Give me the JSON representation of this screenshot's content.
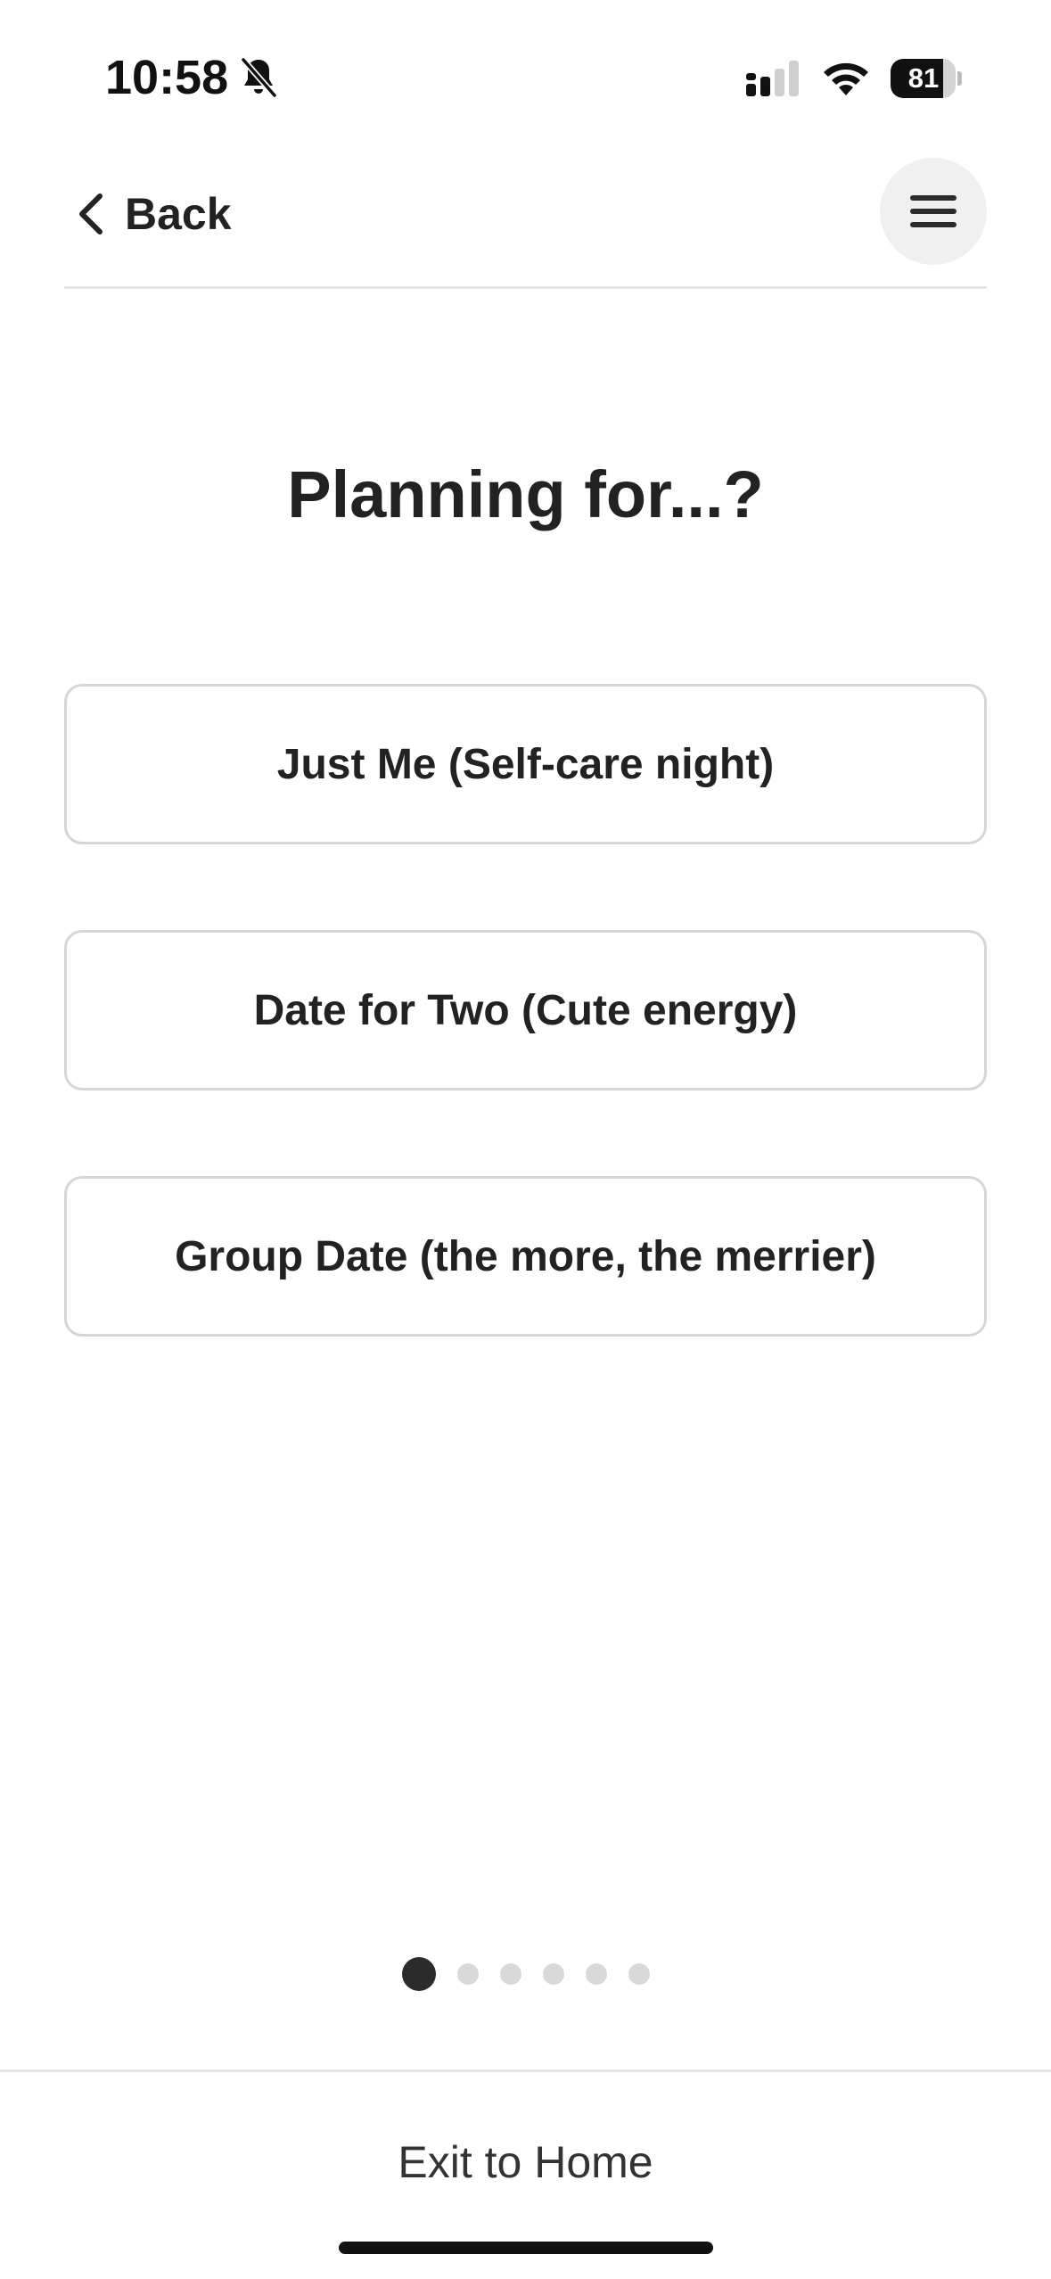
{
  "status_bar": {
    "time": "10:58",
    "battery_level": "81",
    "battery_fraction": 0.81,
    "icons": [
      "bell-slash-icon",
      "cellular-signal-icon",
      "wifi-icon",
      "battery-icon"
    ]
  },
  "header": {
    "back_label": "Back",
    "back_icon": "chevron-left-icon",
    "menu_icon": "hamburger-icon"
  },
  "main": {
    "title": "Planning for...?",
    "options": [
      {
        "label": "Just Me (Self-care night)"
      },
      {
        "label": "Date for Two (Cute energy)"
      },
      {
        "label": "Group Date (the more, the merrier)"
      }
    ]
  },
  "pager": {
    "total_steps": 6,
    "current_step": 1
  },
  "footer": {
    "exit_label": "Exit to Home"
  },
  "colors": {
    "text": "#222222",
    "border": "#d6d6d6",
    "dot_active": "#2b2b2b",
    "dot_inactive": "#d9d9d9",
    "menu_bg": "#f0f0f0"
  }
}
